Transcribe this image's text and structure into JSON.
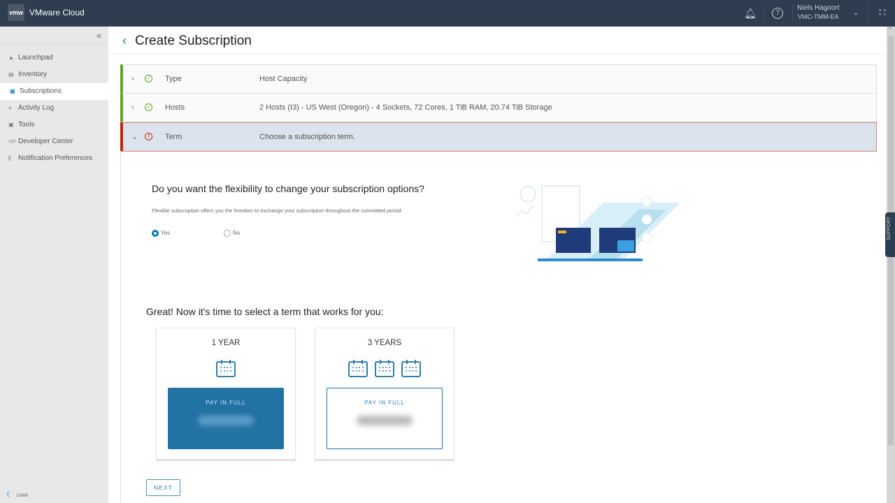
{
  "header": {
    "logo": "vmw",
    "app_title": "VMware Cloud",
    "user_name": "Niels Hagoort",
    "org": "VMC-TMM-EA"
  },
  "sidebar": {
    "items": [
      {
        "label": "Launchpad",
        "icon": "rocket-icon"
      },
      {
        "label": "Inventory",
        "icon": "inventory-icon"
      },
      {
        "label": "Subscriptions",
        "icon": "calendar-icon",
        "active": true
      },
      {
        "label": "Activity Log",
        "icon": "list-icon"
      },
      {
        "label": "Tools",
        "icon": "toolbox-icon"
      },
      {
        "label": "Developer Center",
        "icon": "code-icon"
      },
      {
        "label": "Notification Preferences",
        "icon": "sliders-icon"
      }
    ],
    "dark_label": "DARK"
  },
  "page": {
    "title": "Create Subscription"
  },
  "steps": [
    {
      "label": "Type",
      "value": "Host Capacity",
      "status": "complete"
    },
    {
      "label": "Hosts",
      "value": "2 Hosts (I3) - US West (Oregon) - 4 Sockets, 72 Cores, 1 TiB RAM, 20.74 TiB Storage",
      "status": "complete"
    },
    {
      "label": "Term",
      "value": "Choose a subscription term.",
      "status": "error"
    }
  ],
  "flex": {
    "question": "Do you want the flexibility to change your subscription options?",
    "description": "Flexible subscription offers you the freedom to exchange your subscription throughout the committed period.",
    "yes": "Yes",
    "no": "No",
    "selected": "Yes"
  },
  "term": {
    "heading": "Great! Now it's time to select a term that works for you:",
    "cards": [
      {
        "title": "1 YEAR",
        "pay": "PAY IN FULL",
        "selected": true
      },
      {
        "title": "3 YEARS",
        "pay": "PAY IN FULL",
        "selected": false
      }
    ],
    "next": "NEXT"
  },
  "support": "SUPPORT",
  "colors": {
    "header": "#2e3d4f",
    "accent": "#0079b8",
    "success": "#62a420",
    "error": "#c92100"
  }
}
